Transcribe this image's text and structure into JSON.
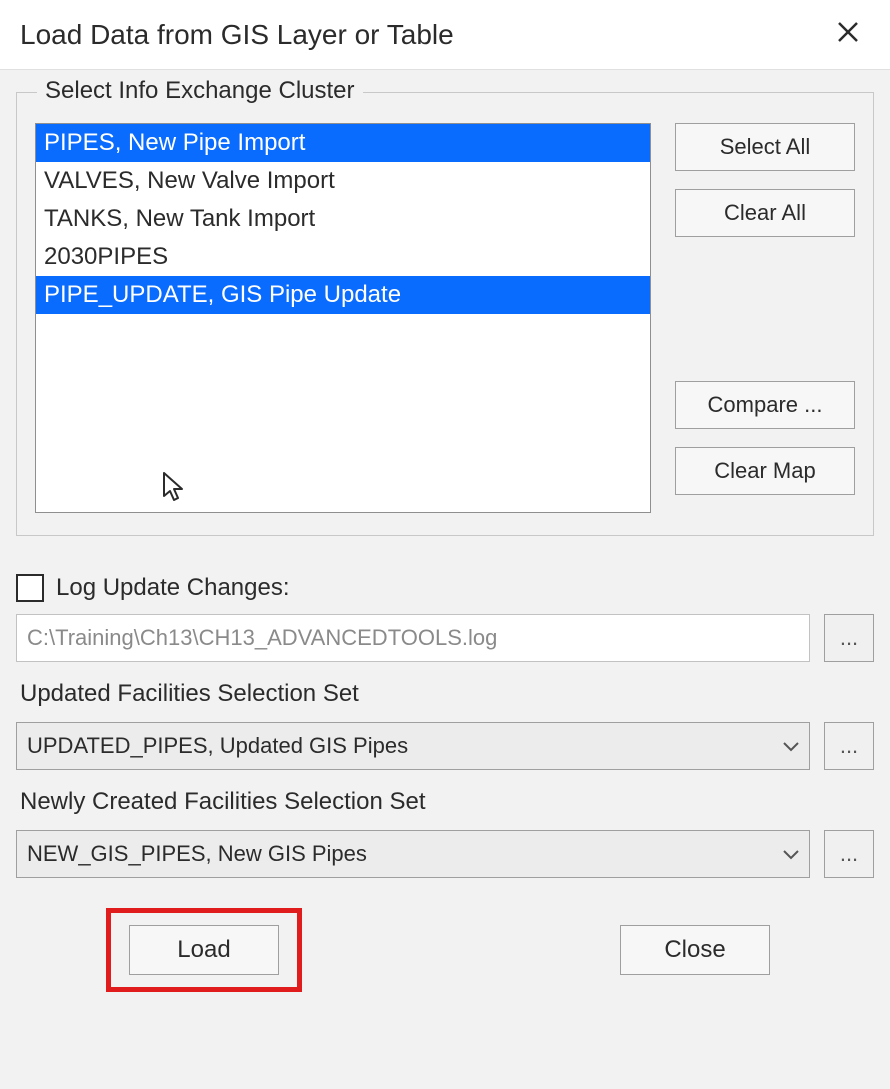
{
  "window": {
    "title": "Load Data from GIS Layer or Table",
    "close_icon": "close-icon"
  },
  "cluster": {
    "legend": "Select Info Exchange Cluster",
    "items": [
      {
        "label": "PIPES, New Pipe Import",
        "selected": true
      },
      {
        "label": "VALVES, New Valve Import",
        "selected": false
      },
      {
        "label": "TANKS, New Tank Import",
        "selected": false
      },
      {
        "label": "2030PIPES",
        "selected": false
      },
      {
        "label": "PIPE_UPDATE, GIS Pipe Update",
        "selected": true
      }
    ],
    "buttons": {
      "select_all": "Select All",
      "clear_all": "Clear All",
      "compare": "Compare ...",
      "clear_map": "Clear Map"
    }
  },
  "log": {
    "checkbox_label": "Log Update Changes:",
    "checked": false,
    "path": "C:\\Training\\Ch13\\CH13_ADVANCEDTOOLS.log",
    "browse": "..."
  },
  "updated_set": {
    "label": "Updated Facilities Selection Set",
    "value": "UPDATED_PIPES, Updated GIS Pipes",
    "browse": "..."
  },
  "new_set": {
    "label": "Newly Created Facilities Selection Set",
    "value": "NEW_GIS_PIPES, New GIS Pipes",
    "browse": "..."
  },
  "actions": {
    "load": "Load",
    "close": "Close"
  }
}
